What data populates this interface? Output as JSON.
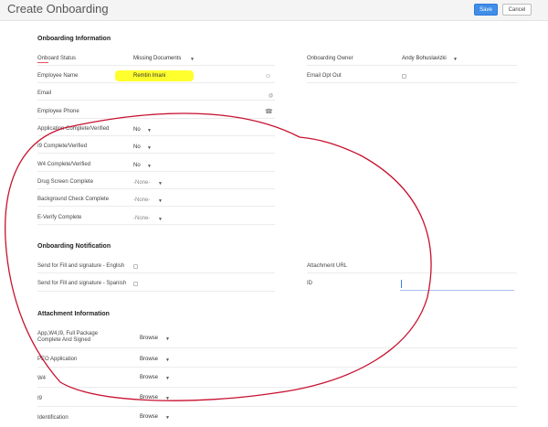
{
  "header": {
    "title": "Create Onboarding",
    "save_label": "Save",
    "cancel_label": "Cancel"
  },
  "sections": {
    "info": "Onboarding Information",
    "notification": "Onboarding Notification",
    "attachment": "Attachment Information"
  },
  "info_left": [
    {
      "label": "Onboard Status",
      "value": "Missing Documents",
      "kind": "select"
    },
    {
      "label": "Employee Name",
      "value": "Remtin Imani",
      "kind": "lookup"
    },
    {
      "label": "Email",
      "value": "",
      "kind": "email"
    },
    {
      "label": "Employee Phone",
      "value": "",
      "kind": "phone"
    },
    {
      "label": "Application Complete/Verified",
      "value": "No",
      "kind": "select"
    },
    {
      "label": "I9 Complete/Verified",
      "value": "No",
      "kind": "select"
    },
    {
      "label": "W4 Complete/Verified",
      "value": "No",
      "kind": "select"
    },
    {
      "label": "Drug Screen Complete",
      "value": "-None-",
      "kind": "select"
    },
    {
      "label": "Background Check Complete",
      "value": "-None-",
      "kind": "select"
    },
    {
      "label": "E-Verify Complete",
      "value": "-None-",
      "kind": "select"
    }
  ],
  "info_right": [
    {
      "label": "Onboarding Owner",
      "value": "Andy Bohuslavizki"
    },
    {
      "label": "Email Opt Out",
      "value": ""
    }
  ],
  "notification_left": [
    {
      "label": "Send for Fill and signature - English"
    },
    {
      "label": "Send for Fill and signature - Spanish"
    }
  ],
  "notification_right": [
    {
      "label": "Attachment URL"
    },
    {
      "label": "ID"
    }
  ],
  "attachments": [
    {
      "label": "App,W4,I9, Full Package Complete And Signed",
      "browse": "Browse"
    },
    {
      "label": "PEO Application",
      "browse": "Browse"
    },
    {
      "label": "W4",
      "browse": "Browse"
    },
    {
      "label": "I9",
      "browse": "Browse"
    },
    {
      "label": "Identification",
      "browse": "Browse"
    }
  ],
  "colors": {
    "accent": "#408ee8",
    "highlight": "#ffff2e",
    "annotation": "#c8102e",
    "required": "#e8505b"
  },
  "icons": {
    "lookup": "person-lookup-icon",
    "email": "mail-icon",
    "phone": "phone-icon",
    "caret": "chevron-down-icon"
  }
}
